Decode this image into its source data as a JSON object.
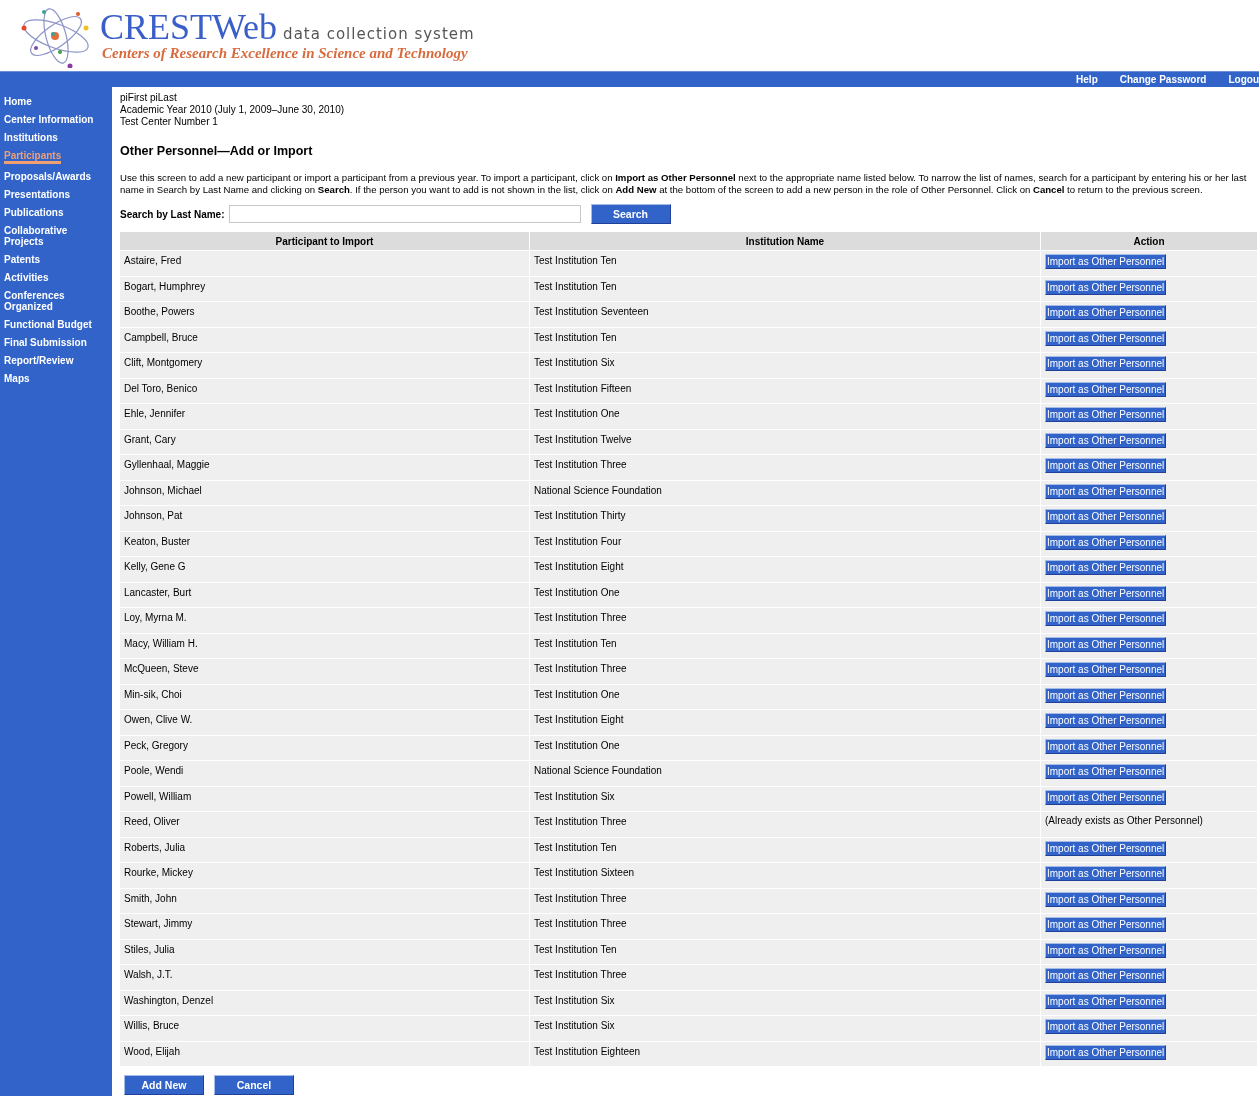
{
  "header": {
    "title": "CRESTWeb",
    "tagline": "data collection system",
    "subtitle": "Centers of Research Excellence in Science and Technology"
  },
  "top_links": [
    "Help",
    "Change Password",
    "Logou"
  ],
  "sidebar": {
    "items": [
      {
        "label": "Home",
        "selected": false
      },
      {
        "label": "Center Information",
        "selected": false
      },
      {
        "label": "Institutions",
        "selected": false
      },
      {
        "label": "Participants",
        "selected": true
      },
      {
        "label": "Proposals/Awards",
        "selected": false
      },
      {
        "label": "Presentations",
        "selected": false
      },
      {
        "label": "Publications",
        "selected": false
      },
      {
        "label": "Collaborative Projects",
        "selected": false
      },
      {
        "label": "Patents",
        "selected": false
      },
      {
        "label": "Activities",
        "selected": false
      },
      {
        "label": "Conferences Organized",
        "selected": false
      },
      {
        "label": "Functional Budget",
        "selected": false
      },
      {
        "label": "Final Submission",
        "selected": false
      },
      {
        "label": "Report/Review",
        "selected": false
      },
      {
        "label": "Maps",
        "selected": false
      }
    ]
  },
  "context": [
    "piFirst piLast",
    "Academic Year 2010 (July 1, 2009–June 30, 2010)",
    "Test Center Number 1"
  ],
  "page_title": "Other Personnel—Add or Import",
  "instructions": "Use this screen to add a new participant or import a participant from a previous year. To import a participant, click on **Import as Other Personnel** next to the appropriate name listed below. To narrow the list of names, search for a participant by entering his or her last name in Search by Last Name and clicking on **Search**. If the person you want to add is not shown in the list, click on **Add New** at the bottom of the screen to add a new person in the role of Other Personnel. Click on **Cancel** to return to the previous screen.",
  "search": {
    "label": "Search by Last Name:",
    "button": "Search"
  },
  "table": {
    "columns": [
      "Participant to Import",
      "Institution Name",
      "Action"
    ],
    "rows": [
      {
        "participant": "Astaire, Fred",
        "institution": "Test Institution Ten",
        "action": {
          "kind": "button",
          "text": "Import as Other Personnel"
        }
      },
      {
        "participant": "Bogart, Humphrey",
        "institution": "Test Institution Ten",
        "action": {
          "kind": "button",
          "text": "Import as Other Personnel"
        }
      },
      {
        "participant": "Boothe, Powers",
        "institution": "Test Institution Seventeen",
        "action": {
          "kind": "button",
          "text": "Import as Other Personnel"
        }
      },
      {
        "participant": "Campbell, Bruce",
        "institution": "Test Institution Ten",
        "action": {
          "kind": "button",
          "text": "Import as Other Personnel"
        }
      },
      {
        "participant": "Clift, Montgomery",
        "institution": "Test Institution Six",
        "action": {
          "kind": "button",
          "text": "Import as Other Personnel"
        }
      },
      {
        "participant": "Del Toro, Benico",
        "institution": "Test Institution Fifteen",
        "action": {
          "kind": "button",
          "text": "Import as Other Personnel"
        }
      },
      {
        "participant": "Ehle, Jennifer",
        "institution": "Test Institution One",
        "action": {
          "kind": "button",
          "text": "Import as Other Personnel"
        }
      },
      {
        "participant": "Grant, Cary",
        "institution": "Test Institution Twelve",
        "action": {
          "kind": "button",
          "text": "Import as Other Personnel"
        }
      },
      {
        "participant": "Gyllenhaal, Maggie",
        "institution": "Test Institution Three",
        "action": {
          "kind": "button",
          "text": "Import as Other Personnel"
        }
      },
      {
        "participant": "Johnson, Michael",
        "institution": "National Science Foundation",
        "action": {
          "kind": "button",
          "text": "Import as Other Personnel"
        }
      },
      {
        "participant": "Johnson, Pat",
        "institution": "Test Institution Thirty",
        "action": {
          "kind": "button",
          "text": "Import as Other Personnel"
        }
      },
      {
        "participant": "Keaton, Buster",
        "institution": "Test Institution Four",
        "action": {
          "kind": "button",
          "text": "Import as Other Personnel"
        }
      },
      {
        "participant": "Kelly, Gene G",
        "institution": "Test Institution Eight",
        "action": {
          "kind": "button",
          "text": "Import as Other Personnel"
        }
      },
      {
        "participant": "Lancaster, Burt",
        "institution": "Test Institution One",
        "action": {
          "kind": "button",
          "text": "Import as Other Personnel"
        }
      },
      {
        "participant": "Loy, Myrna M.",
        "institution": "Test Institution Three",
        "action": {
          "kind": "button",
          "text": "Import as Other Personnel"
        }
      },
      {
        "participant": "Macy, William H.",
        "institution": "Test Institution Ten",
        "action": {
          "kind": "button",
          "text": "Import as Other Personnel"
        }
      },
      {
        "participant": "McQueen, Steve",
        "institution": "Test Institution Three",
        "action": {
          "kind": "button",
          "text": "Import as Other Personnel"
        }
      },
      {
        "participant": "Min-sik, Choi",
        "institution": "Test Institution One",
        "action": {
          "kind": "button",
          "text": "Import as Other Personnel"
        }
      },
      {
        "participant": "Owen, Clive W.",
        "institution": "Test Institution Eight",
        "action": {
          "kind": "button",
          "text": "Import as Other Personnel"
        }
      },
      {
        "participant": "Peck, Gregory",
        "institution": "Test Institution One",
        "action": {
          "kind": "button",
          "text": "Import as Other Personnel"
        }
      },
      {
        "participant": "Poole, Wendi",
        "institution": "National Science Foundation",
        "action": {
          "kind": "button",
          "text": "Import as Other Personnel"
        }
      },
      {
        "participant": "Powell, William",
        "institution": "Test Institution Six",
        "action": {
          "kind": "button",
          "text": "Import as Other Personnel"
        }
      },
      {
        "participant": "Reed, Oliver",
        "institution": "Test Institution Three",
        "action": {
          "kind": "note",
          "text": "(Already exists as Other Personnel)"
        }
      },
      {
        "participant": "Roberts, Julia",
        "institution": "Test Institution Ten",
        "action": {
          "kind": "button",
          "text": "Import as Other Personnel"
        }
      },
      {
        "participant": "Rourke, Mickey",
        "institution": "Test Institution Sixteen",
        "action": {
          "kind": "button",
          "text": "Import as Other Personnel"
        }
      },
      {
        "participant": "Smith, John",
        "institution": "Test Institution Three",
        "action": {
          "kind": "button",
          "text": "Import as Other Personnel"
        }
      },
      {
        "participant": "Stewart, Jimmy",
        "institution": "Test Institution Three",
        "action": {
          "kind": "button",
          "text": "Import as Other Personnel"
        }
      },
      {
        "participant": "Stiles, Julia",
        "institution": "Test Institution Ten",
        "action": {
          "kind": "button",
          "text": "Import as Other Personnel"
        }
      },
      {
        "participant": "Walsh, J.T.",
        "institution": "Test Institution Three",
        "action": {
          "kind": "button",
          "text": "Import as Other Personnel"
        }
      },
      {
        "participant": "Washington, Denzel",
        "institution": "Test Institution Six",
        "action": {
          "kind": "button",
          "text": "Import as Other Personnel"
        }
      },
      {
        "participant": "Willis, Bruce",
        "institution": "Test Institution Six",
        "action": {
          "kind": "button",
          "text": "Import as Other Personnel"
        }
      },
      {
        "participant": "Wood, Elijah",
        "institution": "Test Institution Eighteen",
        "action": {
          "kind": "button",
          "text": "Import as Other Personnel"
        }
      }
    ]
  },
  "buttons": [
    "Add New",
    "Cancel"
  ]
}
